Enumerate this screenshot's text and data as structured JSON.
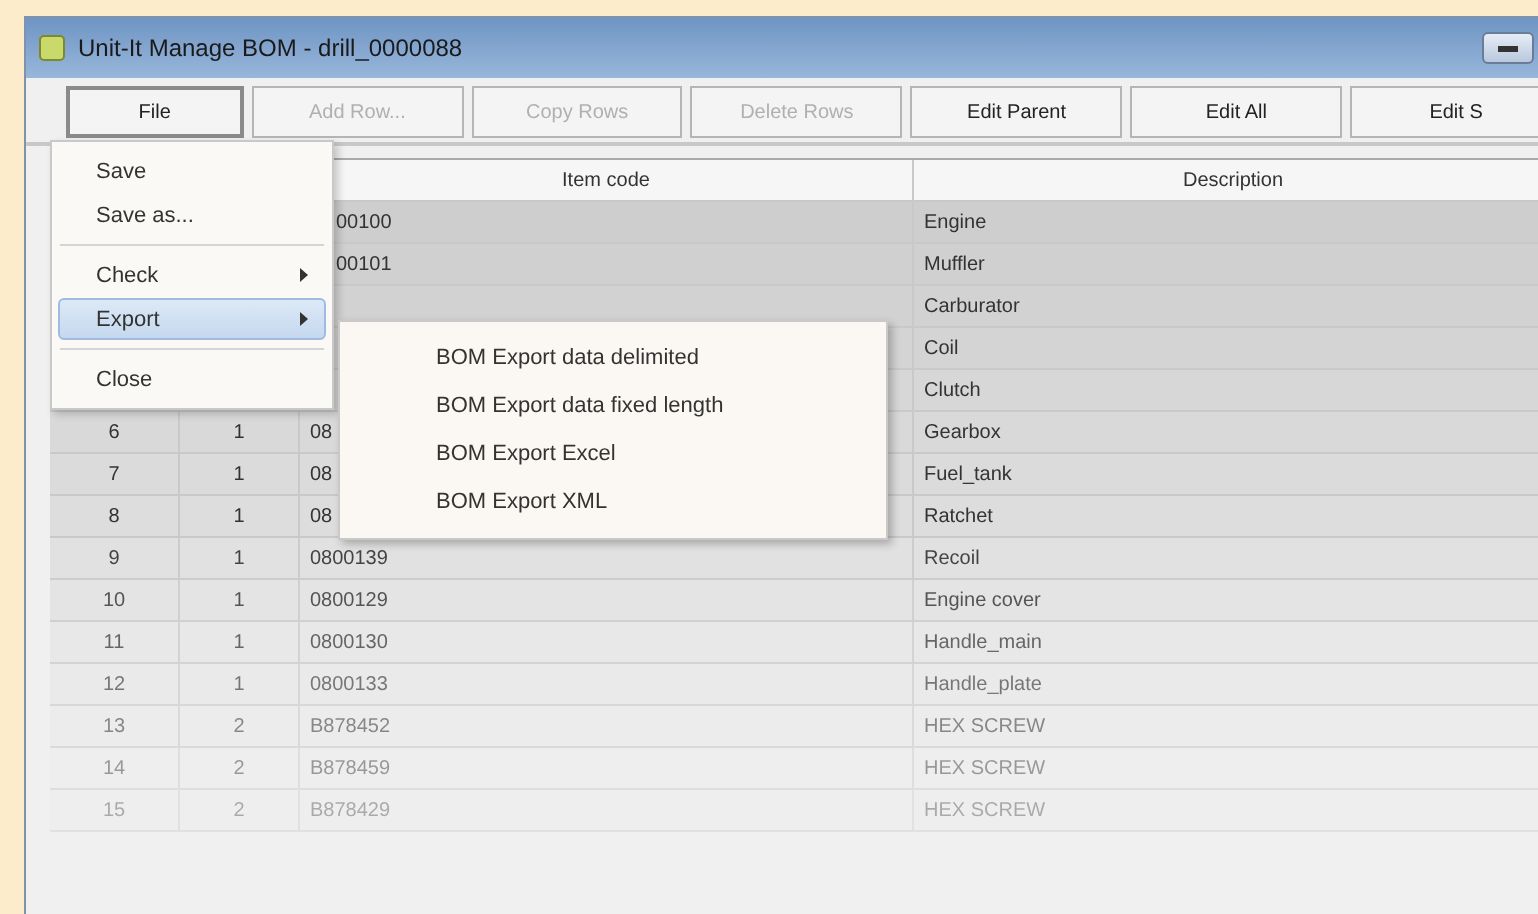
{
  "window": {
    "title": "Unit-It Manage BOM - drill_0000088"
  },
  "toolbar": [
    {
      "label": "File",
      "disabled": false
    },
    {
      "label": "Add Row...",
      "disabled": true
    },
    {
      "label": "Copy Rows",
      "disabled": true
    },
    {
      "label": "Delete Rows",
      "disabled": true
    },
    {
      "label": "Edit Parent",
      "disabled": false
    },
    {
      "label": "Edit All",
      "disabled": false
    },
    {
      "label": "Edit S",
      "disabled": false
    }
  ],
  "table": {
    "columns": [
      "Item code",
      "Description"
    ],
    "rows": [
      {
        "item_code": "00100",
        "description": "Engine"
      },
      {
        "item_code": "00101",
        "description": "Muffler"
      },
      {
        "description": "Carburator"
      },
      {
        "description": "Coil"
      },
      {
        "description": "Clutch"
      },
      {
        "number": "6",
        "level": "1",
        "item_code": "08",
        "description": "Gearbox"
      },
      {
        "number": "7",
        "level": "1",
        "item_code": "08",
        "description": "Fuel_tank"
      },
      {
        "number": "8",
        "level": "1",
        "item_code": "08",
        "description": "Ratchet"
      },
      {
        "number": "9",
        "level": "1",
        "item_code": "0800139",
        "description": "Recoil"
      },
      {
        "number": "10",
        "level": "1",
        "item_code": "0800129",
        "description": "Engine cover"
      },
      {
        "number": "11",
        "level": "1",
        "item_code": "0800130",
        "description": "Handle_main"
      },
      {
        "number": "12",
        "level": "1",
        "item_code": "0800133",
        "description": "Handle_plate"
      },
      {
        "number": "13",
        "level": "2",
        "item_code": "B878452",
        "description": "HEX SCREW"
      },
      {
        "number": "14",
        "level": "2",
        "item_code": "B878459",
        "description": "HEX SCREW"
      },
      {
        "number": "15",
        "level": "2",
        "item_code": "B878429",
        "description": "HEX SCREW"
      }
    ]
  },
  "file_menu": [
    {
      "kind": "item",
      "label": "Save",
      "has_submenu": false,
      "selected": false
    },
    {
      "kind": "item",
      "label": "Save as...",
      "has_submenu": false,
      "selected": false
    },
    {
      "kind": "separator"
    },
    {
      "kind": "item",
      "label": "Check",
      "has_submenu": true,
      "selected": false
    },
    {
      "kind": "item",
      "label": "Export",
      "has_submenu": true,
      "selected": true
    },
    {
      "kind": "separator"
    },
    {
      "kind": "item",
      "label": "Close",
      "has_submenu": false,
      "selected": false
    }
  ],
  "export_submenu": [
    {
      "label": "BOM Export data delimited"
    },
    {
      "label": "BOM Export data fixed length"
    },
    {
      "label": "BOM Export Excel"
    },
    {
      "label": "BOM Export XML"
    }
  ]
}
